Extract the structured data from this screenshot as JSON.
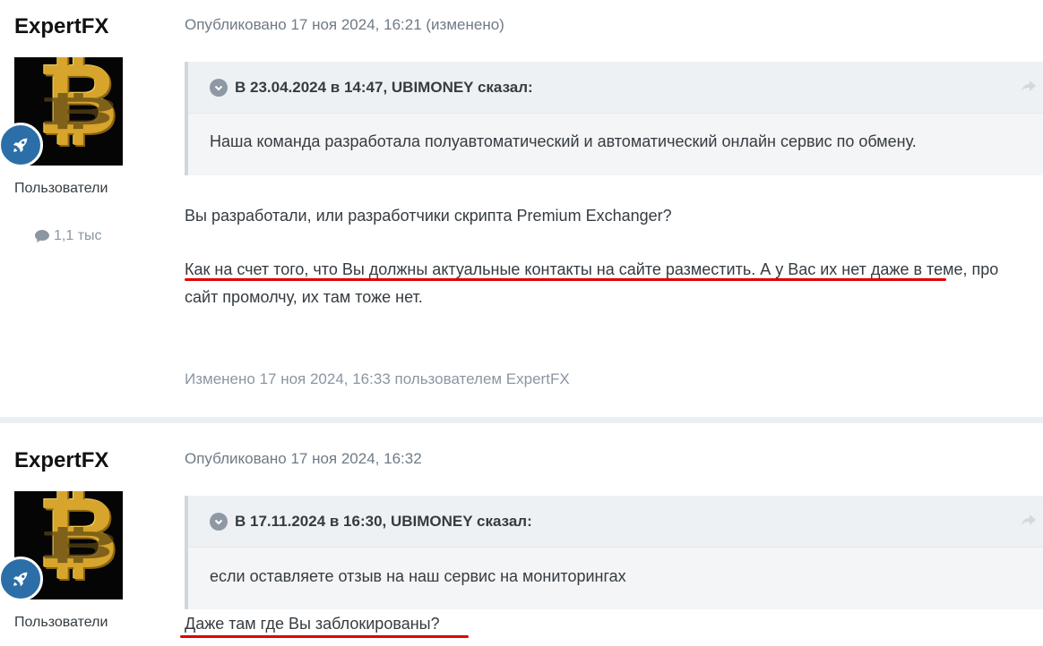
{
  "posts": [
    {
      "author": "ExpertFX",
      "group": "Пользователи",
      "post_count": "1,1 тыс",
      "meta": "Опубликовано 17 ноя 2024, 16:21 (изменено)",
      "quote": {
        "title": "В 23.04.2024 в 14:47, UBIMONEY сказал:",
        "body": "Наша команда разработала полуавтоматический и автоматический онлайн сервис по обмену."
      },
      "paragraphs": [
        "Вы разработали, или разработчики скрипта Premium Exchanger?",
        "Как на счет того, что Вы должны актуальные контакты на сайте разместить. А у Вас их нет даже в теме, про сайт промолчу, их там тоже нет."
      ],
      "edited": "Изменено 17 ноя 2024, 16:33 пользователем ExpertFX"
    },
    {
      "author": "ExpertFX",
      "group": "Пользователи",
      "meta": "Опубликовано 17 ноя 2024, 16:32",
      "quote": {
        "title": "В 17.11.2024 в 16:30, UBIMONEY сказал:",
        "body": "если оставляете отзыв на наш сервис на мониторингах"
      },
      "paragraphs": [
        "Даже там где Вы заблокированы?"
      ]
    }
  ],
  "icons": {
    "avatar": "bitcoin-icon",
    "badge": "rocket-icon",
    "count": "speech-bubble-icon",
    "quote_toggle": "chevron-down-icon",
    "quote_share": "share-arrow-icon"
  },
  "colors": {
    "badge": "#2c6fa8",
    "highlight_underline": "#e00000",
    "bitcoin_gold": "#d7a52c"
  }
}
